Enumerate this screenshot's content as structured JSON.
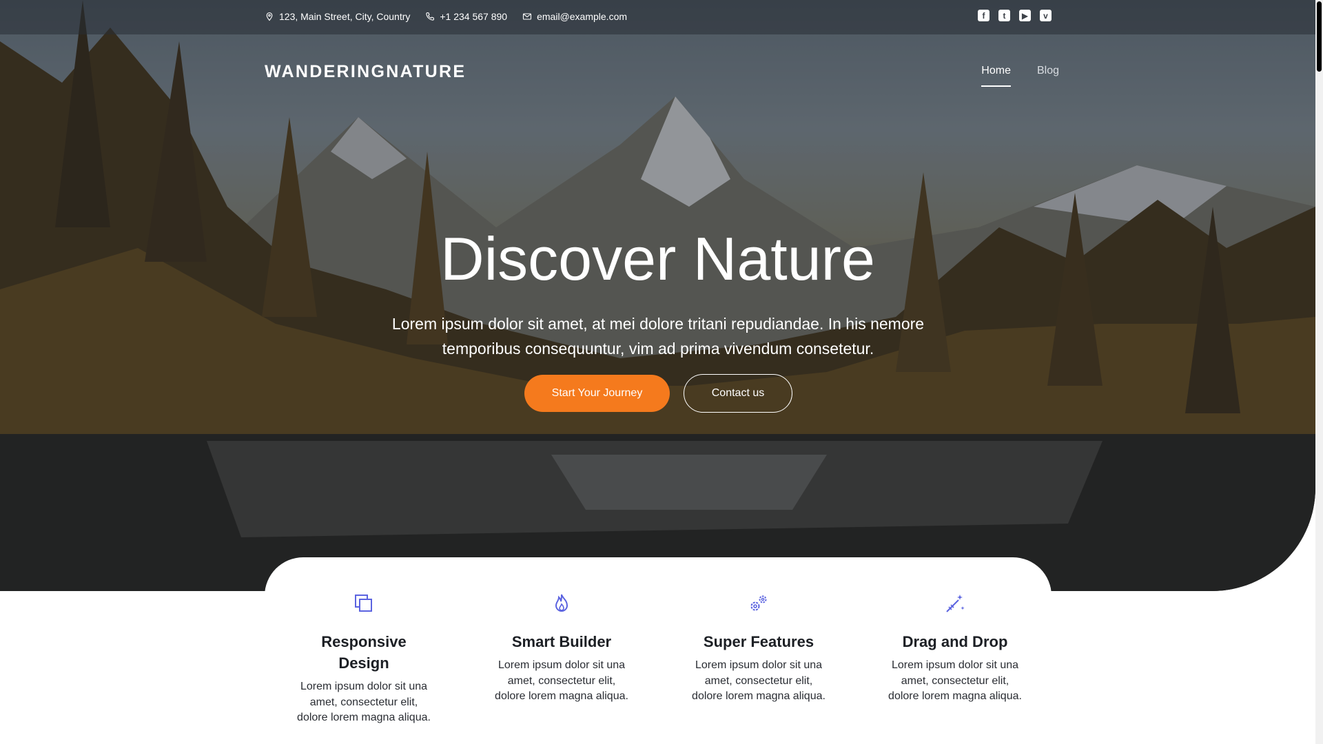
{
  "topbar": {
    "address": "123, Main Street, City, Country",
    "phone": "+1 234 567 890",
    "email": "email@example.com",
    "socials": [
      "facebook-icon",
      "twitter-icon",
      "youtube-icon",
      "vimeo-icon"
    ]
  },
  "brand": {
    "logo": "WANDERINGNATURE"
  },
  "nav": {
    "items": [
      {
        "label": "Home",
        "active": true
      },
      {
        "label": "Blog",
        "active": false
      }
    ]
  },
  "hero": {
    "title": "Discover Nature",
    "subtitle": "Lorem ipsum dolor sit amet, at mei dolore tritani repudiandae. In his nemore temporibus consequuntur, vim ad prima vivendum consetetur.",
    "primary_button": "Start Your Journey",
    "secondary_button": "Contact us"
  },
  "features": [
    {
      "icon": "layers-icon",
      "title": "Responsive Design",
      "text": "Lorem ipsum dolor sit una amet, consectetur elit, dolore lorem magna aliqua."
    },
    {
      "icon": "flame-icon",
      "title": "Smart Builder",
      "text": "Lorem ipsum dolor sit una amet, consectetur elit, dolore lorem magna aliqua."
    },
    {
      "icon": "gears-icon",
      "title": "Super Features",
      "text": "Lorem ipsum dolor sit una amet, consectetur elit, dolore lorem magna aliqua."
    },
    {
      "icon": "magic-wand-icon",
      "title": "Drag and Drop",
      "text": "Lorem ipsum dolor sit una amet, consectetur elit, dolore lorem magna aliqua."
    }
  ],
  "colors": {
    "accent": "#f57a1d",
    "icon": "#5b63e0",
    "text_dark": "#1c1f24"
  }
}
